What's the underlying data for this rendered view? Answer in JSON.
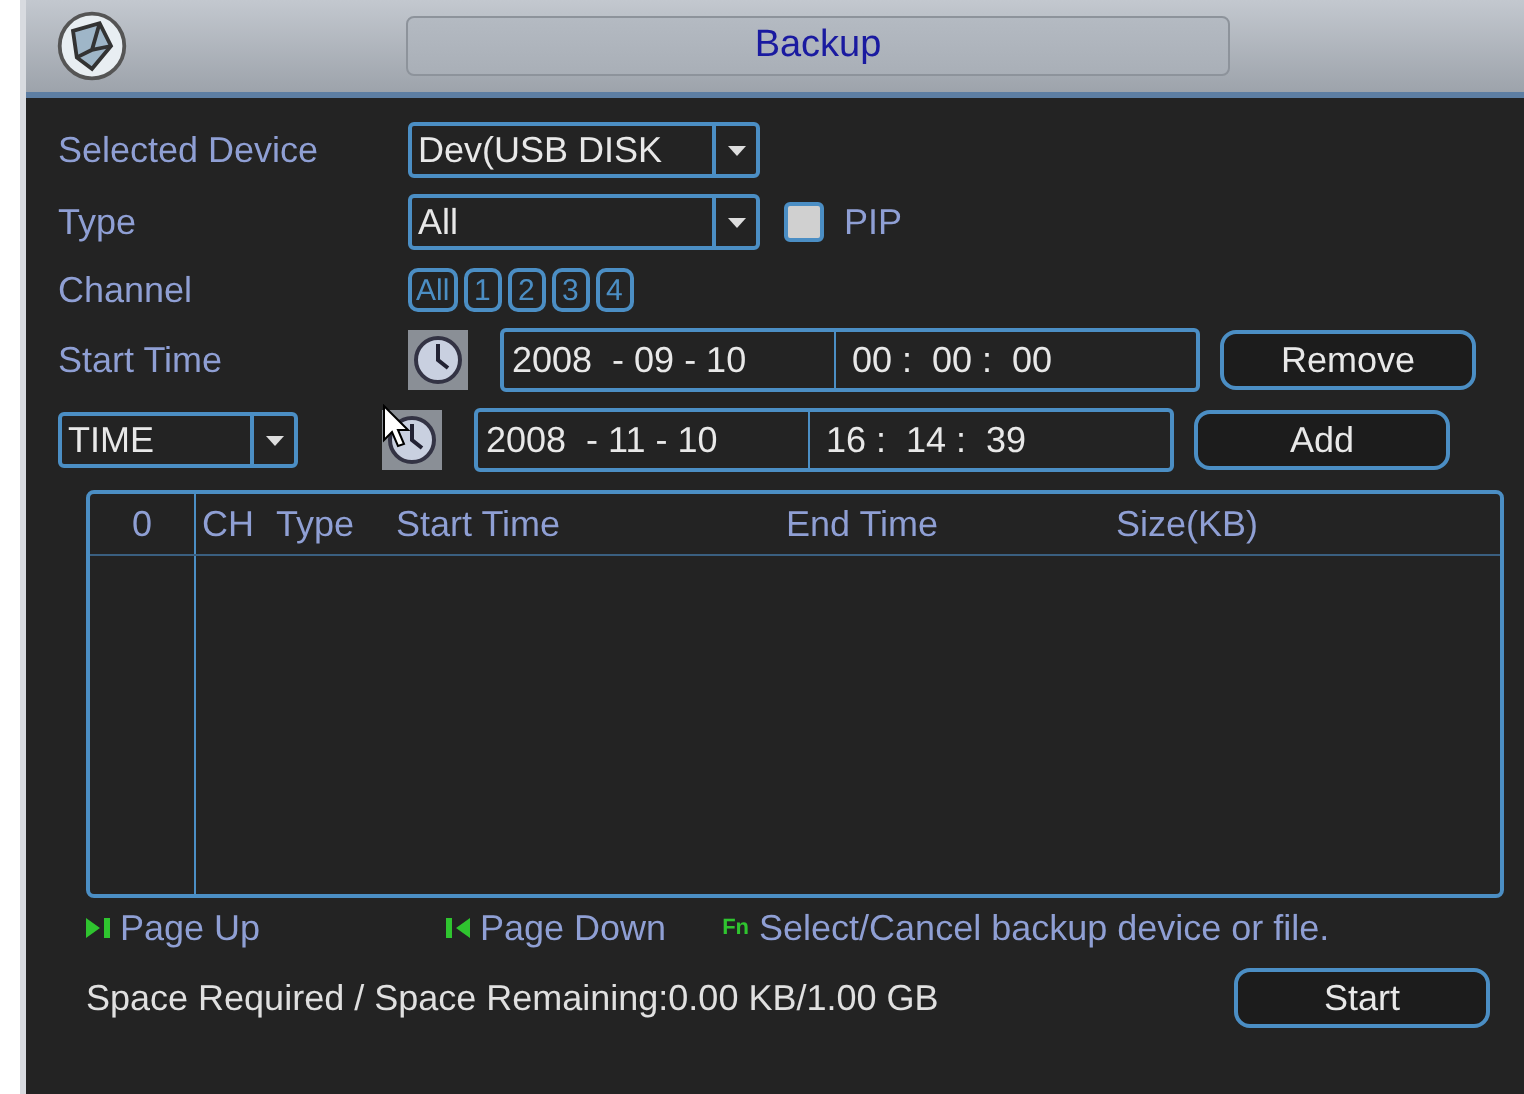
{
  "window": {
    "title": "Backup"
  },
  "selected_device": {
    "label": "Selected Device",
    "value": "Dev(USB DISK"
  },
  "type": {
    "label": "Type",
    "value": "All",
    "pip": {
      "label": "PIP",
      "checked": false
    }
  },
  "channel": {
    "label": "Channel",
    "options": [
      "All",
      "1",
      "2",
      "3",
      "4"
    ]
  },
  "start_time": {
    "label": "Start Time",
    "date": "2008  - 09 - 10",
    "time": "00 :  00 :  00",
    "button": "Remove"
  },
  "end_time": {
    "mode": "TIME",
    "date": "2008  - 11 - 10",
    "time": "16 :  14 :  39",
    "button": "Add"
  },
  "table": {
    "columns": [
      "0",
      "CH",
      "Type",
      "Start Time",
      "End Time",
      "Size(KB)"
    ]
  },
  "hints": [
    {
      "kind": "next",
      "text": "Page Up"
    },
    {
      "kind": "prev",
      "text": "Page Down"
    },
    {
      "kind": "fn",
      "key": "Fn",
      "text": "Select/Cancel backup device or file."
    }
  ],
  "status": "Space Required / Space Remaining:0.00 KB/1.00 GB",
  "start_button": "Start"
}
